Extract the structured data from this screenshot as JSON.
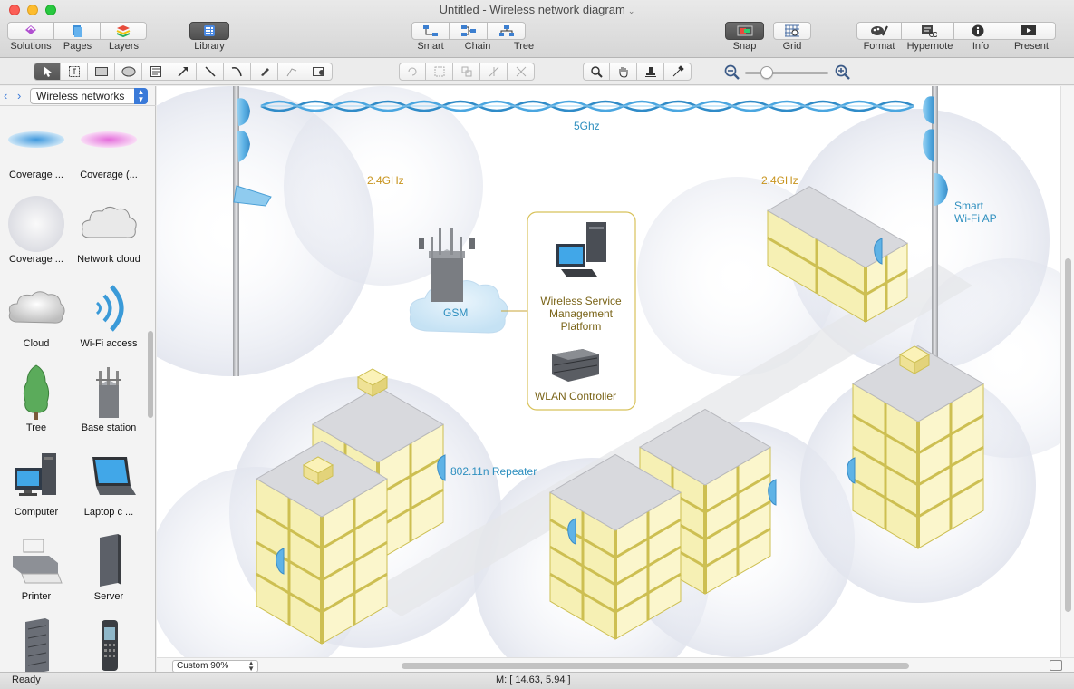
{
  "window": {
    "title": "Untitled - Wireless network diagram"
  },
  "toolbar": {
    "solutions": "Solutions",
    "pages": "Pages",
    "layers": "Layers",
    "library": "Library",
    "smart": "Smart",
    "chain": "Chain",
    "tree": "Tree",
    "snap": "Snap",
    "grid": "Grid",
    "format": "Format",
    "hypernote": "Hypernote",
    "info": "Info",
    "present": "Present"
  },
  "sidebar": {
    "library_name": "Wireless networks",
    "items": [
      {
        "label": "Coverage ...",
        "icon": "coverage-blue-icon"
      },
      {
        "label": "Coverage (...",
        "icon": "coverage-pink-icon"
      },
      {
        "label": "Coverage ...",
        "icon": "coverage-circle-icon"
      },
      {
        "label": "Network cloud",
        "icon": "network-cloud-icon"
      },
      {
        "label": "Cloud",
        "icon": "cloud-icon"
      },
      {
        "label": "Wi-Fi access",
        "icon": "wifi-access-icon"
      },
      {
        "label": "Tree",
        "icon": "tree-icon"
      },
      {
        "label": "Base station",
        "icon": "base-station-icon"
      },
      {
        "label": "Computer",
        "icon": "computer-icon"
      },
      {
        "label": "Laptop c ...",
        "icon": "laptop-icon"
      },
      {
        "label": "Printer",
        "icon": "printer-icon"
      },
      {
        "label": "Server",
        "icon": "server-icon"
      },
      {
        "label": "",
        "icon": "rack-server-icon"
      },
      {
        "label": "",
        "icon": "mobile-phone-icon"
      }
    ]
  },
  "diagram": {
    "band_5ghz": "5Ghz",
    "band_left": "2.4GHz",
    "band_right": "2.4GHz",
    "gsm": "GSM",
    "platform_line1": "Wireless Service",
    "platform_line2": "Management",
    "platform_line3": "Platform",
    "wlan": "WLAN Controller",
    "repeater": "802.11n Repeater",
    "smart_ap_line1": "Smart",
    "smart_ap_line2": "Wi-Fi AP"
  },
  "bottom": {
    "zoom": "Custom 90%"
  },
  "status": {
    "ready": "Ready",
    "coordinates": "M: [ 14.63, 5.94 ]"
  },
  "colors": {
    "accent": "#3a7ad9",
    "label_orange": "#c8941e",
    "label_blue": "#2e8fbf",
    "building_fill": "#f6f0b4",
    "building_stroke": "#cdbf52",
    "roof": "#d8d9dd"
  }
}
